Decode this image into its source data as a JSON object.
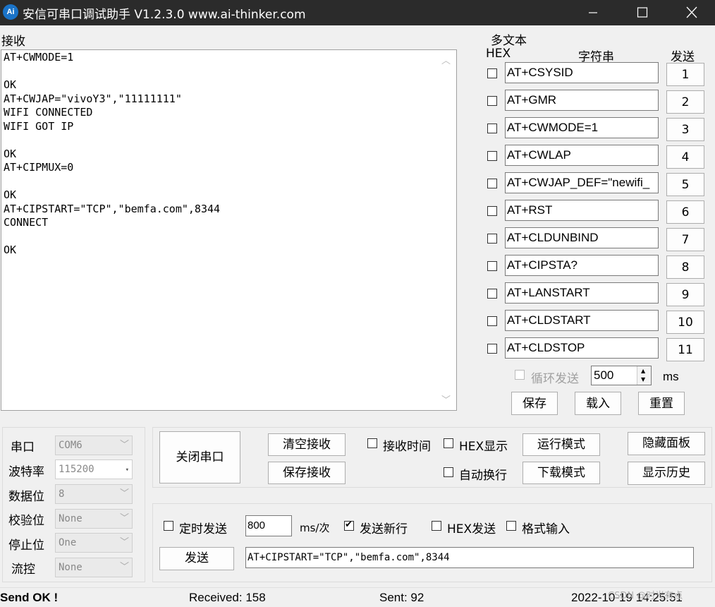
{
  "window": {
    "icon_text": "Ai",
    "title": "安信可串口调试助手 V1.2.3.0     www.ai-thinker.com"
  },
  "receive": {
    "label": "接收",
    "lines": [
      "AT+CWMODE=1",
      "",
      "OK",
      "AT+CWJAP=\"vivoY3\",\"11111111\"",
      "WIFI CONNECTED",
      "WIFI GOT IP",
      "",
      "OK",
      "AT+CIPMUX=0",
      "",
      "OK",
      "AT+CIPSTART=\"TCP\",\"bemfa.com\",8344",
      "CONNECT",
      "",
      "OK"
    ]
  },
  "multi_text": {
    "label": "多文本",
    "col_hex": "HEX",
    "col_string": "字符串",
    "col_send": "发送",
    "rows": [
      {
        "value": "AT+CSYSID",
        "button": "1"
      },
      {
        "value": "AT+GMR",
        "button": "2"
      },
      {
        "value": "AT+CWMODE=1",
        "button": "3"
      },
      {
        "value": "AT+CWLAP",
        "button": "4"
      },
      {
        "value": "AT+CWJAP_DEF=\"newifi_",
        "button": "5"
      },
      {
        "value": "AT+RST",
        "button": "6"
      },
      {
        "value": "AT+CLDUNBIND",
        "button": "7"
      },
      {
        "value": "AT+CIPSTA?",
        "button": "8"
      },
      {
        "value": "AT+LANSTART",
        "button": "9"
      },
      {
        "value": "AT+CLDSTART",
        "button": "10"
      },
      {
        "value": "AT+CLDSTOP",
        "button": "11"
      }
    ],
    "loop_send_label": "循环发送",
    "loop_interval": "500",
    "loop_unit": "ms",
    "save_label": "保存",
    "load_label": "载入",
    "reset_label": "重置"
  },
  "port_settings": {
    "port_label": "串口",
    "port_value": "COM6",
    "baud_label": "波特率",
    "baud_value": "115200",
    "databits_label": "数据位",
    "databits_value": "8",
    "parity_label": "校验位",
    "parity_value": "None",
    "stopbits_label": "停止位",
    "stopbits_value": "One",
    "flow_label": "流控",
    "flow_value": "None"
  },
  "controls": {
    "close_port": "关闭串口",
    "clear_receive": "清空接收",
    "save_receive": "保存接收",
    "recv_time": "接收时间",
    "hex_display": "HEX显示",
    "auto_wrap": "自动换行",
    "run_mode": "运行模式",
    "download_mode": "下载模式",
    "hide_panel": "隐藏面板",
    "show_history": "显示历史"
  },
  "send": {
    "timed_send": "定时发送",
    "interval": "800",
    "interval_unit": "ms/次",
    "send_newline": "发送新行",
    "hex_send": "HEX发送",
    "format_input": "格式输入",
    "send_button": "发送",
    "input_value": "AT+CIPSTART=\"TCP\",\"bemfa.com\",8344"
  },
  "status": {
    "send_status": "Send OK !",
    "received": "Received: 158",
    "sent": "Sent: 92",
    "datetime": "2022-10-19 14:25:51",
    "watermark": "CSDN @时光有点"
  }
}
